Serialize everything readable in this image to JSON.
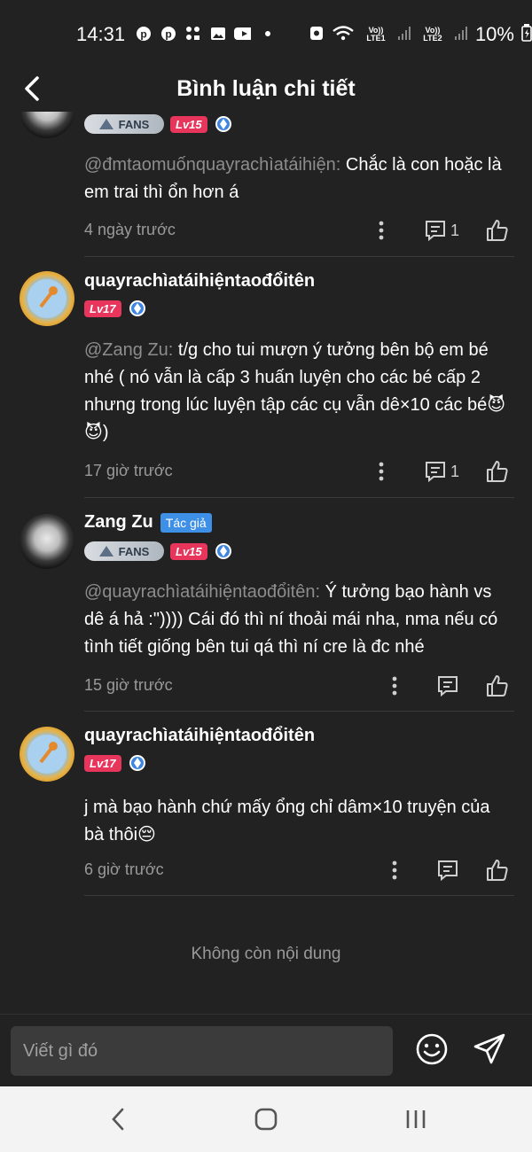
{
  "status_bar": {
    "time": "14:31",
    "notif_icons": [
      "pinterest-icon",
      "pinterest-icon",
      "app-grid-icon",
      "image-icon",
      "youtube-icon",
      "dot-icon"
    ],
    "sim1": "Vo)) LTE1",
    "sim2": "Vo)) LTE2",
    "battery": "10%"
  },
  "header": {
    "title": "Bình luận chi tiết"
  },
  "comments": [
    {
      "username": "",
      "fans_label": "FANS",
      "level": "Lv15",
      "mention": "@đmtaomuốnquayrachìatáihiện:",
      "text": " Chắc là con hoặc là em trai thì ổn hơn á",
      "time": "4 ngày trước",
      "reply_count": "1"
    },
    {
      "username": "quayrachìatáihiệntaođổitên",
      "level": "Lv17",
      "mention": "@Zang Zu:",
      "text": " t/g cho tui mượn ý tưởng bên bộ em bé nhé ( nó vẫn là cấp 3 huấn luyện cho các bé cấp 2 nhưng trong lúc luyện tập các cụ vẫn dê×10 các bé😈😈)",
      "time": "17 giờ trước",
      "reply_count": "1"
    },
    {
      "username": "Zang Zu",
      "author_tag": "Tác giả",
      "fans_label": "FANS",
      "level": "Lv15",
      "mention": "@quayrachìatáihiệntaođổitên:",
      "text": " Ý tưởng bạo hành vs dê á hả :\")))) Cái đó thì ní thoải mái nha, nma nếu có tình tiết giống bên tui qá thì ní cre là đc nhé",
      "time": "15 giờ trước"
    },
    {
      "username": "quayrachìatáihiệntaođổitên",
      "level": "Lv17",
      "text": "j mà bạo hành chứ mấy ổng chỉ dâm×10 truyện của bà thôi😔",
      "time": "6 giờ trước"
    }
  ],
  "footer_note": "Không còn nội dung",
  "input": {
    "placeholder": "Viết gì đó"
  },
  "colors": {
    "background": "#222222",
    "level_badge": "#e8355c",
    "author_tag": "#3e8fe6",
    "muted_text": "#9a9a9a"
  }
}
